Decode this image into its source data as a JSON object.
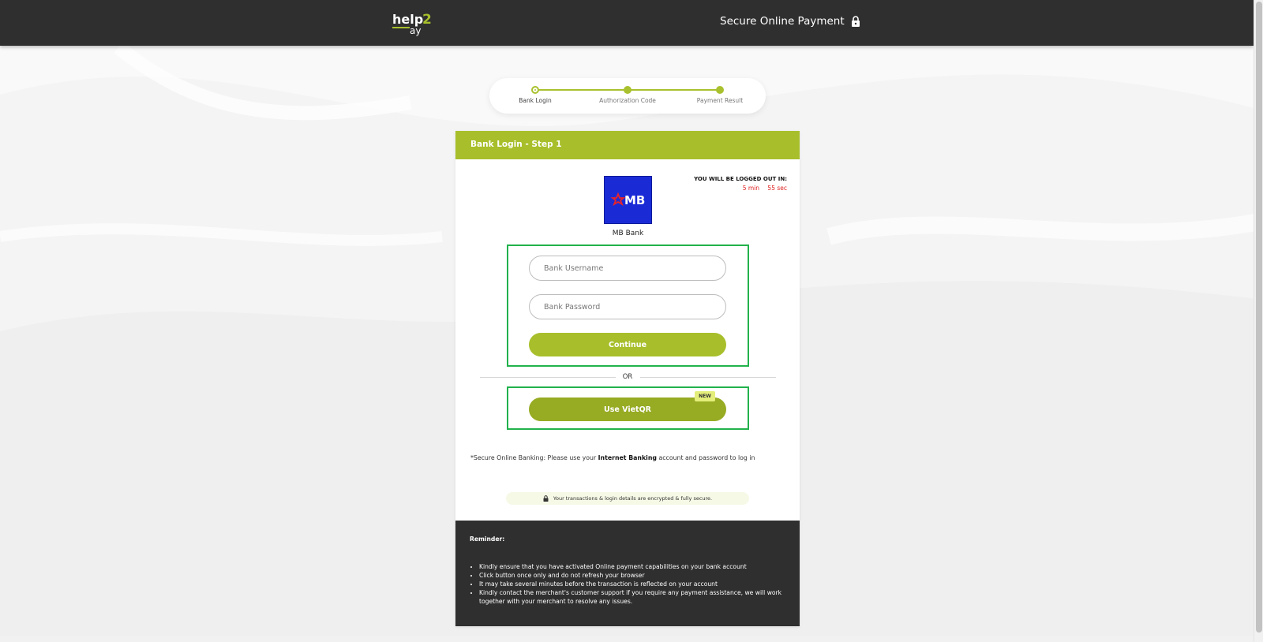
{
  "header": {
    "logo_text": "help2pay",
    "secure_label": "Secure Online Payment",
    "lock_icon": "lock-icon"
  },
  "stepper": {
    "steps": [
      {
        "label": "Bank Login",
        "state": "active"
      },
      {
        "label": "Authorization Code",
        "state": "pending"
      },
      {
        "label": "Payment Result",
        "state": "pending"
      }
    ]
  },
  "card": {
    "title": "Bank Login - Step 1",
    "bank": {
      "name": "MB Bank",
      "logo_text": "MB"
    },
    "timer": {
      "title": "YOU WILL BE LOGGED OUT IN:",
      "minutes": "5 min",
      "seconds": "55 sec"
    },
    "form": {
      "username_placeholder": "Bank Username",
      "password_placeholder": "Bank Password",
      "continue_label": "Continue"
    },
    "or_text": "OR",
    "vietqr_label": "Use VietQR",
    "new_badge": "NEW",
    "secure_note_prefix": "*Secure Online Banking: Please use your ",
    "secure_note_bold": "Internet Banking",
    "secure_note_suffix": " account and password to log in",
    "encrypt_note": "Your transactions & login details are encrypted & fully secure."
  },
  "reminder": {
    "title": "Reminder:",
    "items": [
      "Kindly ensure that you have activated Online payment capabilities on your bank account",
      "Click button once only and do not refresh your browser",
      "It may take several minutes before the transaction is reflected on your account",
      "Kindly contact the merchant's customer support if you require any payment assistance, we will work together with your merchant to resolve any issues."
    ]
  },
  "colors": {
    "brand_green": "#a8bf2b",
    "dark_bar": "#2f2f2f",
    "highlight_box": "#22b24c",
    "timer_red": "#e02020",
    "bank_blue": "#1a2bd6"
  }
}
